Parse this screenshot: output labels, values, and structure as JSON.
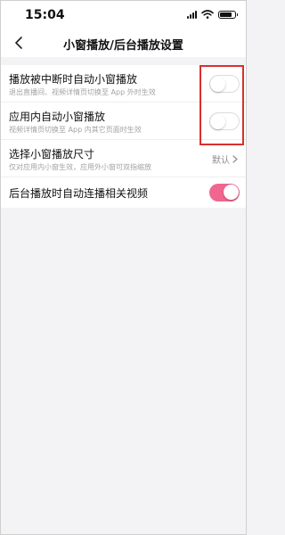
{
  "status_bar": {
    "time": "15:04",
    "battery_level": 0.85
  },
  "nav": {
    "title": "小窗播放/后台播放设置",
    "back_icon": "chevron-left-icon"
  },
  "settings": [
    {
      "label": "播放被中断时自动小窗播放",
      "sub": "退出直播间、视频详情页切换至 App 外时生效",
      "toggle": "off"
    },
    {
      "label": "应用内自动小窗播放",
      "sub": "视频详情页切换至 App 内其它页面时生效",
      "toggle": "off"
    },
    {
      "label": "选择小窗播放尺寸",
      "sub": "仅对应用内小窗生效，应用外小窗可双指缩放",
      "value": "默认"
    },
    {
      "label": "后台播放时自动连播相关视频",
      "toggle": "on"
    }
  ],
  "colors": {
    "accent": "#f0668f",
    "highlight": "#d9302c"
  }
}
